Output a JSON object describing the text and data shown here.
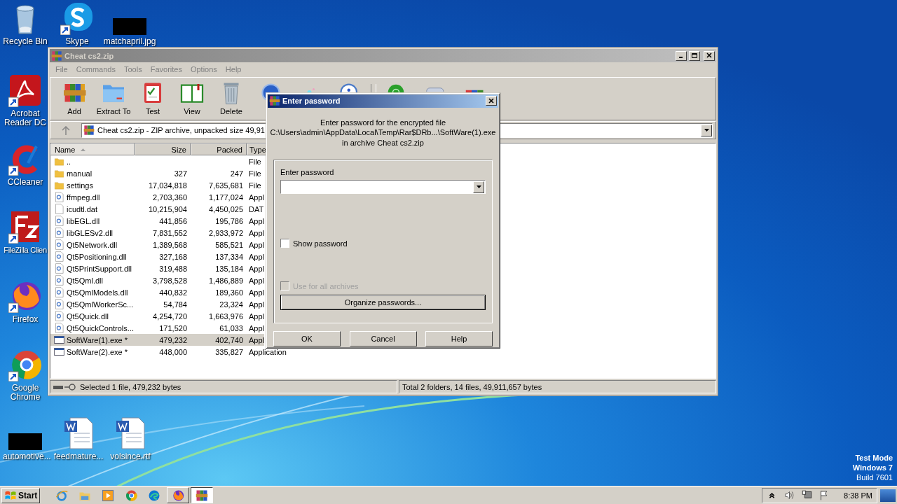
{
  "desktop_icons": [
    {
      "label": "Recycle Bin",
      "kind": "recycle",
      "shortcut": false
    },
    {
      "label": "Skype",
      "kind": "skype",
      "shortcut": true
    },
    {
      "label": "matchapril.jpg",
      "kind": "redacted",
      "shortcut": false
    },
    {
      "label": "Acrobat Reader DC",
      "kind": "acrobat",
      "shortcut": true
    },
    {
      "label": "CCleaner",
      "kind": "ccleaner",
      "shortcut": true
    },
    {
      "label": "FileZilla Clien",
      "kind": "filezilla",
      "shortcut": true
    },
    {
      "label": "Firefox",
      "kind": "firefox",
      "shortcut": true
    },
    {
      "label": "Google Chrome",
      "kind": "chrome",
      "shortcut": true
    },
    {
      "label": "automotive...",
      "kind": "redacted",
      "shortcut": false
    },
    {
      "label": "feedmature...",
      "kind": "word",
      "shortcut": false
    },
    {
      "label": "volsince.rtf",
      "kind": "word",
      "shortcut": false
    }
  ],
  "window": {
    "title": "Cheat cs2.zip",
    "active": false,
    "menu": [
      "File",
      "Commands",
      "Tools",
      "Favorites",
      "Options",
      "Help"
    ],
    "toolbar": [
      {
        "label": "Add",
        "kind": "add"
      },
      {
        "label": "Extract To",
        "kind": "extract"
      },
      {
        "label": "Test",
        "kind": "test"
      },
      {
        "label": "View",
        "kind": "view"
      },
      {
        "label": "Delete",
        "kind": "delete"
      },
      {
        "kind": "find"
      },
      {
        "kind": "wizard"
      },
      {
        "kind": "info"
      },
      {
        "kind": "separator"
      },
      {
        "kind": "scan"
      },
      {
        "kind": "comment"
      },
      {
        "kind": "sfx"
      }
    ],
    "address": "Cheat cs2.zip - ZIP archive, unpacked size 49,91",
    "columns": [
      {
        "label": "Name",
        "sorted": true
      },
      {
        "label": "Size",
        "sorted": false
      },
      {
        "label": "Packed",
        "sorted": false
      },
      {
        "label": "Type",
        "sorted": false
      }
    ],
    "rows": [
      {
        "kind": "folder",
        "name": "..",
        "size": "",
        "packed": "",
        "type": "File",
        "selected": false
      },
      {
        "kind": "folder",
        "name": "manual",
        "size": "327",
        "packed": "247",
        "type": "File",
        "selected": false
      },
      {
        "kind": "folder",
        "name": "settings",
        "size": "17,034,818",
        "packed": "7,635,681",
        "type": "File",
        "selected": false
      },
      {
        "kind": "dll",
        "name": "ffmpeg.dll",
        "size": "2,703,360",
        "packed": "1,177,024",
        "type": "Appl",
        "selected": false
      },
      {
        "kind": "file",
        "name": "icudtl.dat",
        "size": "10,215,904",
        "packed": "4,450,025",
        "type": "DAT",
        "selected": false
      },
      {
        "kind": "dll",
        "name": "libEGL.dll",
        "size": "441,856",
        "packed": "195,786",
        "type": "Appl",
        "selected": false
      },
      {
        "kind": "dll",
        "name": "libGLESv2.dll",
        "size": "7,831,552",
        "packed": "2,933,972",
        "type": "Appl",
        "selected": false
      },
      {
        "kind": "dll",
        "name": "Qt5Network.dll",
        "size": "1,389,568",
        "packed": "585,521",
        "type": "Appl",
        "selected": false
      },
      {
        "kind": "dll",
        "name": "Qt5Positioning.dll",
        "size": "327,168",
        "packed": "137,334",
        "type": "Appl",
        "selected": false
      },
      {
        "kind": "dll",
        "name": "Qt5PrintSupport.dll",
        "size": "319,488",
        "packed": "135,184",
        "type": "Appl",
        "selected": false
      },
      {
        "kind": "dll",
        "name": "Qt5Qml.dll",
        "size": "3,798,528",
        "packed": "1,486,889",
        "type": "Appl",
        "selected": false
      },
      {
        "kind": "dll",
        "name": "Qt5QmlModels.dll",
        "size": "440,832",
        "packed": "189,360",
        "type": "Appl",
        "selected": false
      },
      {
        "kind": "dll",
        "name": "Qt5QmlWorkerSc...",
        "size": "54,784",
        "packed": "23,324",
        "type": "Appl",
        "selected": false
      },
      {
        "kind": "dll",
        "name": "Qt5Quick.dll",
        "size": "4,254,720",
        "packed": "1,663,976",
        "type": "Appl",
        "selected": false
      },
      {
        "kind": "dll",
        "name": "Qt5QuickControls...",
        "size": "171,520",
        "packed": "61,033",
        "type": "Appl",
        "selected": false
      },
      {
        "kind": "exe",
        "name": "SoftWare(1).exe *",
        "size": "479,232",
        "packed": "402,740",
        "type": "Appl",
        "selected": true
      },
      {
        "kind": "exe",
        "name": "SoftWare(2).exe *",
        "size": "448,000",
        "packed": "335,827",
        "type": "Application",
        "selected": false
      }
    ],
    "status_left": "Selected 1 file, 479,232 bytes",
    "status_right": "Total 2 folders, 14 files, 49,911,657 bytes"
  },
  "dialog": {
    "title": "Enter password",
    "active": true,
    "message": [
      "Enter password for the encrypted file",
      "C:\\Users\\admin\\AppData\\Local\\Temp\\Rar$DRb...\\SoftWare(1).exe",
      "in archive Cheat cs2.zip"
    ],
    "field_label": "Enter password",
    "checkboxes": [
      {
        "label": "Show password",
        "checked": false,
        "disabled": false
      },
      {
        "label": "Use for all archives",
        "checked": false,
        "disabled": true
      }
    ],
    "organize_button": "Organize passwords...",
    "buttons": [
      "OK",
      "Cancel",
      "Help"
    ]
  },
  "watermark_text": [
    "Test Mode",
    "Windows 7",
    "Build 7601"
  ],
  "taskbar": {
    "start": "Start",
    "items": [
      {
        "kind": "ie",
        "open": false,
        "selected": false
      },
      {
        "kind": "explorer",
        "open": false,
        "selected": false
      },
      {
        "kind": "media",
        "open": false,
        "selected": false
      },
      {
        "kind": "chrome",
        "open": false,
        "selected": false
      },
      {
        "kind": "edge",
        "open": false,
        "selected": false
      },
      {
        "kind": "firefox",
        "open": true,
        "selected": false
      },
      {
        "kind": "winrar",
        "open": true,
        "selected": true
      }
    ],
    "tray": [
      {
        "kind": "chevron"
      },
      {
        "kind": "speaker"
      },
      {
        "kind": "network"
      },
      {
        "kind": "flag"
      }
    ],
    "clock": "8:38 PM"
  }
}
